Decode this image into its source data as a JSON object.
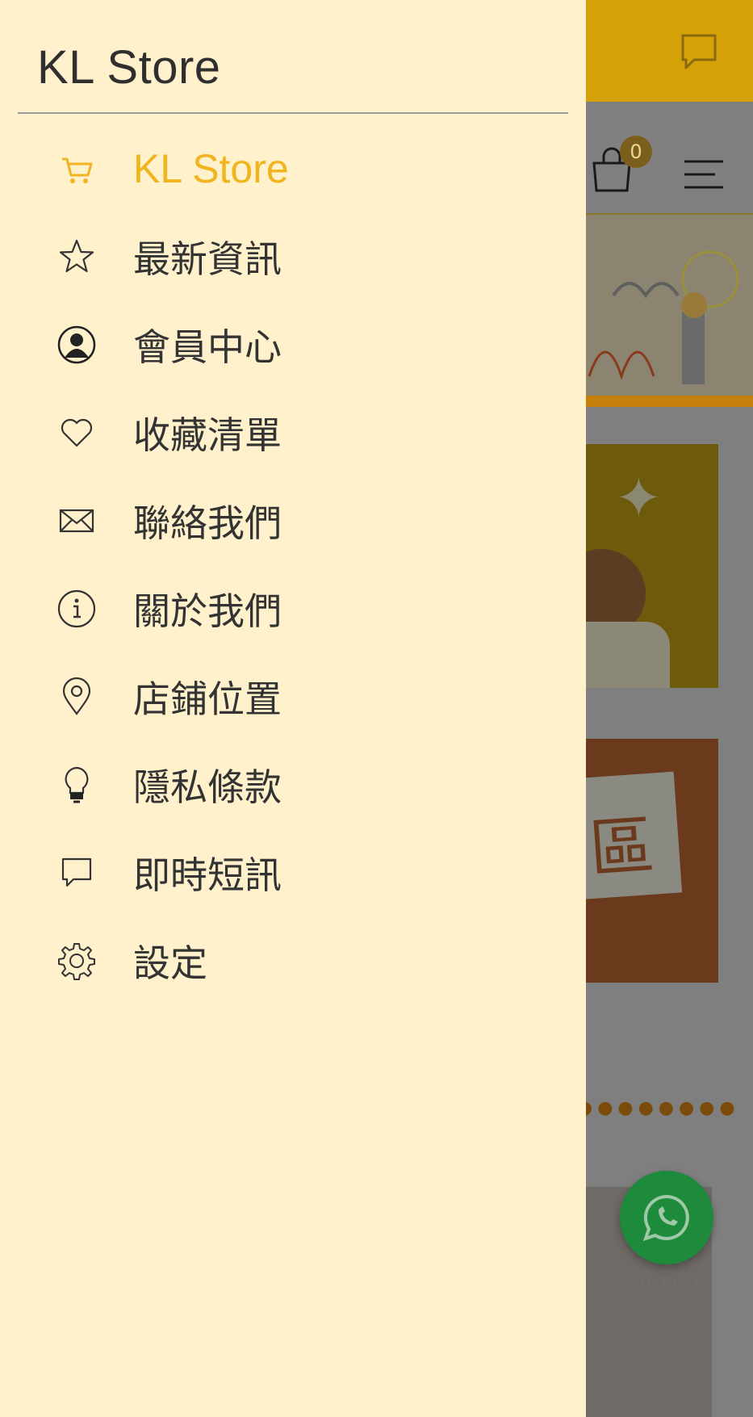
{
  "background": {
    "cart_badge": "0",
    "banner_word": "區",
    "whatsapp_caption": "Solution"
  },
  "drawer": {
    "title": "KL Store",
    "items": [
      {
        "label": "KL Store",
        "icon": "cart-icon",
        "active": true
      },
      {
        "label": "最新資訊",
        "icon": "star-icon"
      },
      {
        "label": "會員中心",
        "icon": "user-icon"
      },
      {
        "label": "收藏清單",
        "icon": "heart-icon"
      },
      {
        "label": "聯絡我們",
        "icon": "mail-icon"
      },
      {
        "label": "關於我們",
        "icon": "info-icon"
      },
      {
        "label": "店鋪位置",
        "icon": "location-pin-icon"
      },
      {
        "label": "隱私條款",
        "icon": "lightbulb-icon"
      },
      {
        "label": "即時短訊",
        "icon": "chat-icon"
      },
      {
        "label": "設定",
        "icon": "gear-icon"
      }
    ]
  },
  "colors": {
    "drawer_bg": "#fff1cc",
    "accent": "#f0b41e",
    "text": "#333333"
  }
}
